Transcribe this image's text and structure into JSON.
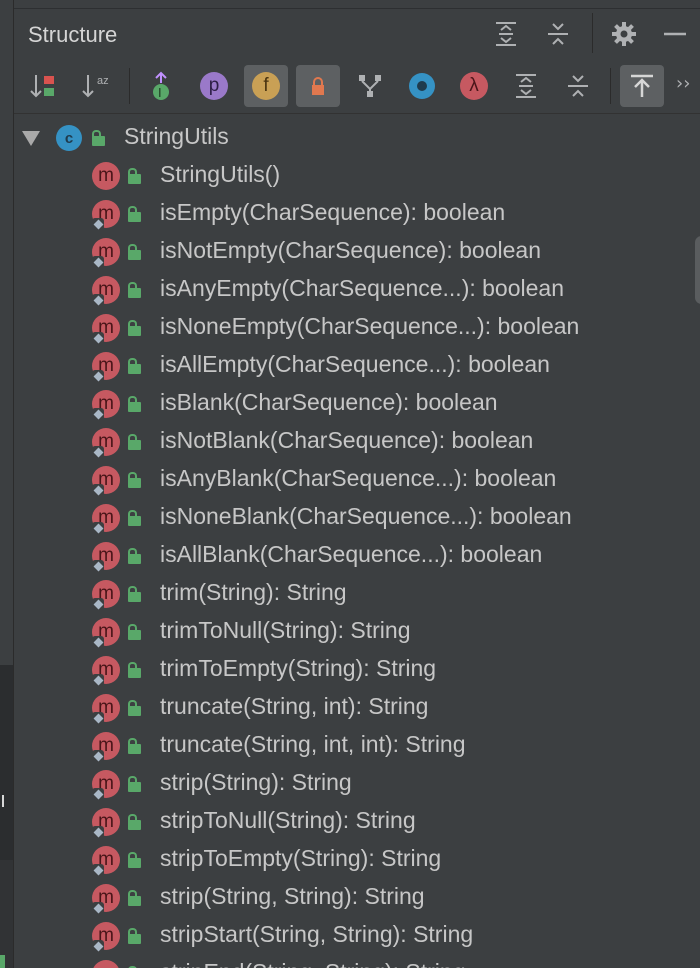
{
  "panel": {
    "title": "Structure"
  },
  "root": {
    "icon_letter": "c",
    "label": "StringUtils"
  },
  "method_icon_letter": "m",
  "toolbar": {
    "more_label": "››",
    "inherited_letter": "I",
    "properties_letter": "p",
    "fields_letter": "f",
    "lambda_letter": "λ",
    "sort_alpha_letters": "az"
  },
  "methods": [
    {
      "label": "StringUtils()",
      "static": false
    },
    {
      "label": "isEmpty(CharSequence): boolean",
      "static": true
    },
    {
      "label": "isNotEmpty(CharSequence): boolean",
      "static": true
    },
    {
      "label": "isAnyEmpty(CharSequence...): boolean",
      "static": true
    },
    {
      "label": "isNoneEmpty(CharSequence...): boolean",
      "static": true
    },
    {
      "label": "isAllEmpty(CharSequence...): boolean",
      "static": true
    },
    {
      "label": "isBlank(CharSequence): boolean",
      "static": true
    },
    {
      "label": "isNotBlank(CharSequence): boolean",
      "static": true
    },
    {
      "label": "isAnyBlank(CharSequence...): boolean",
      "static": true
    },
    {
      "label": "isNoneBlank(CharSequence...): boolean",
      "static": true
    },
    {
      "label": "isAllBlank(CharSequence...): boolean",
      "static": true
    },
    {
      "label": "trim(String): String",
      "static": true
    },
    {
      "label": "trimToNull(String): String",
      "static": true
    },
    {
      "label": "trimToEmpty(String): String",
      "static": true
    },
    {
      "label": "truncate(String, int): String",
      "static": true
    },
    {
      "label": "truncate(String, int, int): String",
      "static": true
    },
    {
      "label": "strip(String): String",
      "static": true
    },
    {
      "label": "stripToNull(String): String",
      "static": true
    },
    {
      "label": "stripToEmpty(String): String",
      "static": true
    },
    {
      "label": "strip(String, String): String",
      "static": true
    },
    {
      "label": "stripStart(String, String): String",
      "static": true
    },
    {
      "label": "stripEnd(String, String): String",
      "static": true
    }
  ],
  "colors": {
    "background": "#3c3f41",
    "method_icon": "#c65961",
    "class_icon": "#3592c4",
    "public_lock": "#59a869",
    "active_toggle": "#5d6062"
  }
}
